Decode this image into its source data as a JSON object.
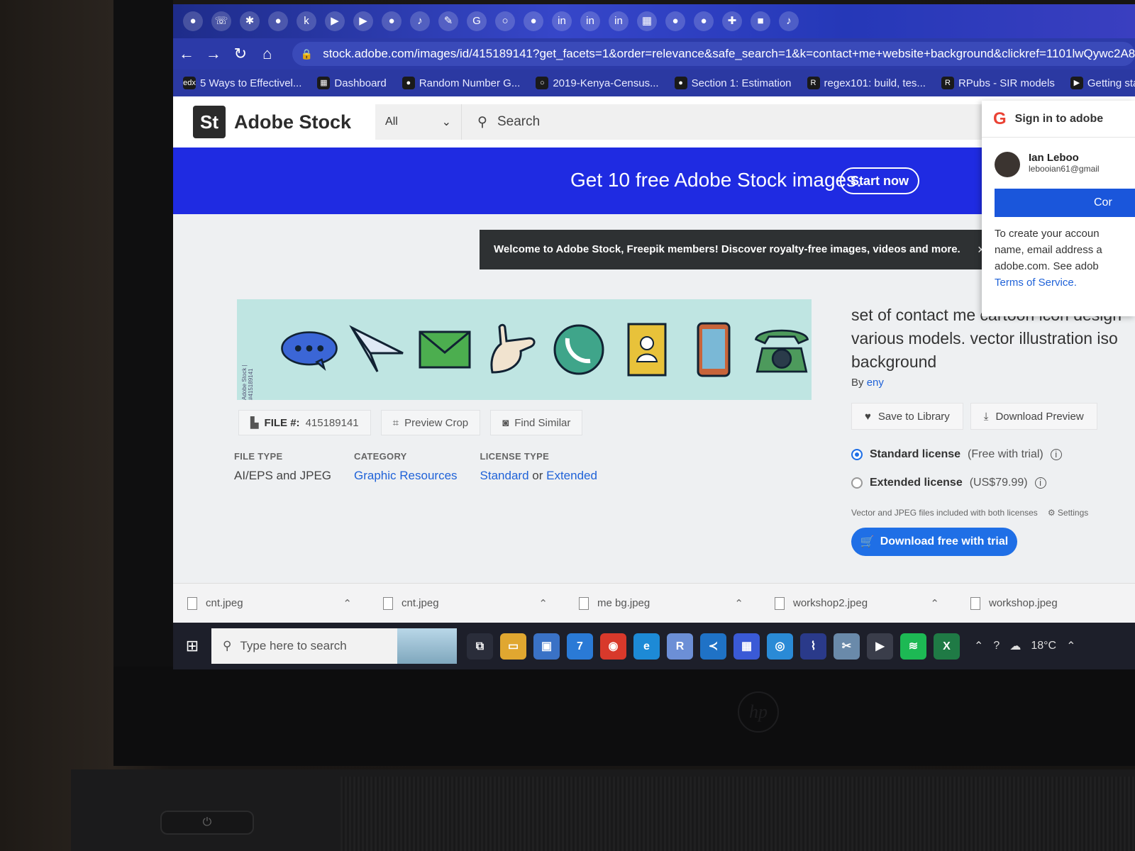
{
  "browser": {
    "url": "stock.adobe.com/images/id/415189141?get_facets=1&order=relevance&safe_search=1&k=contact+me+website+background&clickref=1101lwQywc2A8",
    "bookmarks": [
      "5 Ways to Effectivel...",
      "Dashboard",
      "Random Number G...",
      "2019-Kenya-Census...",
      "Section 1: Estimation",
      "regex101: build, tes...",
      "RPubs - SIR models",
      "Getting started"
    ],
    "tab_icons": [
      "in",
      "in",
      "in"
    ]
  },
  "header": {
    "logo": "St",
    "brand": "Adobe Stock",
    "filter": "All",
    "search_placeholder": "Search"
  },
  "promo": {
    "text": "Get 10 free Adobe Stock images.",
    "button": "Start now"
  },
  "toast": {
    "text": "Welcome to Adobe Stock, Freepik members! Discover royalty-free images, videos and more.",
    "close": "×"
  },
  "preview": {
    "watermark": "Adobe Stock | #415189141"
  },
  "actions": {
    "file_label": "FILE #:",
    "file_number": "415189141",
    "preview_crop": "Preview Crop",
    "find_similar": "Find Similar"
  },
  "meta": {
    "file_type_label": "FILE TYPE",
    "file_type": "AI/EPS and JPEG",
    "category_label": "CATEGORY",
    "category": "Graphic Resources",
    "license_label": "LICENSE TYPE",
    "license_standard": "Standard",
    "license_or": "or",
    "license_extended": "Extended"
  },
  "details": {
    "title_line1": "set of contact me cartoon icon design",
    "title_line2": "various models. vector illustration iso",
    "title_line3": "background",
    "by": "By",
    "author": "eny",
    "save_library": "Save to Library",
    "download_preview": "Download Preview",
    "standard_license": "Standard license",
    "standard_note": "(Free with trial)",
    "extended_license": "Extended license",
    "extended_note": "(US$79.99)",
    "files_note": "Vector and JPEG files included with both licenses",
    "settings": "Settings",
    "download_btn": "Download free with trial"
  },
  "google_popup": {
    "title": "Sign in to adobe",
    "name": "Ian Leboo",
    "email": "lebooian61@gmail",
    "button": "Cor",
    "text_lines": [
      "To create your accoun",
      "name, email address a",
      "adobe.com. See adob"
    ],
    "tos": "Terms of Service."
  },
  "downloads": [
    "cnt.jpeg",
    "cnt.jpeg",
    "me bg.jpeg",
    "workshop2.jpeg",
    "workshop.jpeg"
  ],
  "taskbar": {
    "search_placeholder": "Type here to search",
    "temperature": "18°C",
    "mail_badge": "7"
  },
  "colors": {
    "adobe_blue": "#1f2be2",
    "cta_blue": "#1f6fe6",
    "link": "#1f62d8"
  }
}
